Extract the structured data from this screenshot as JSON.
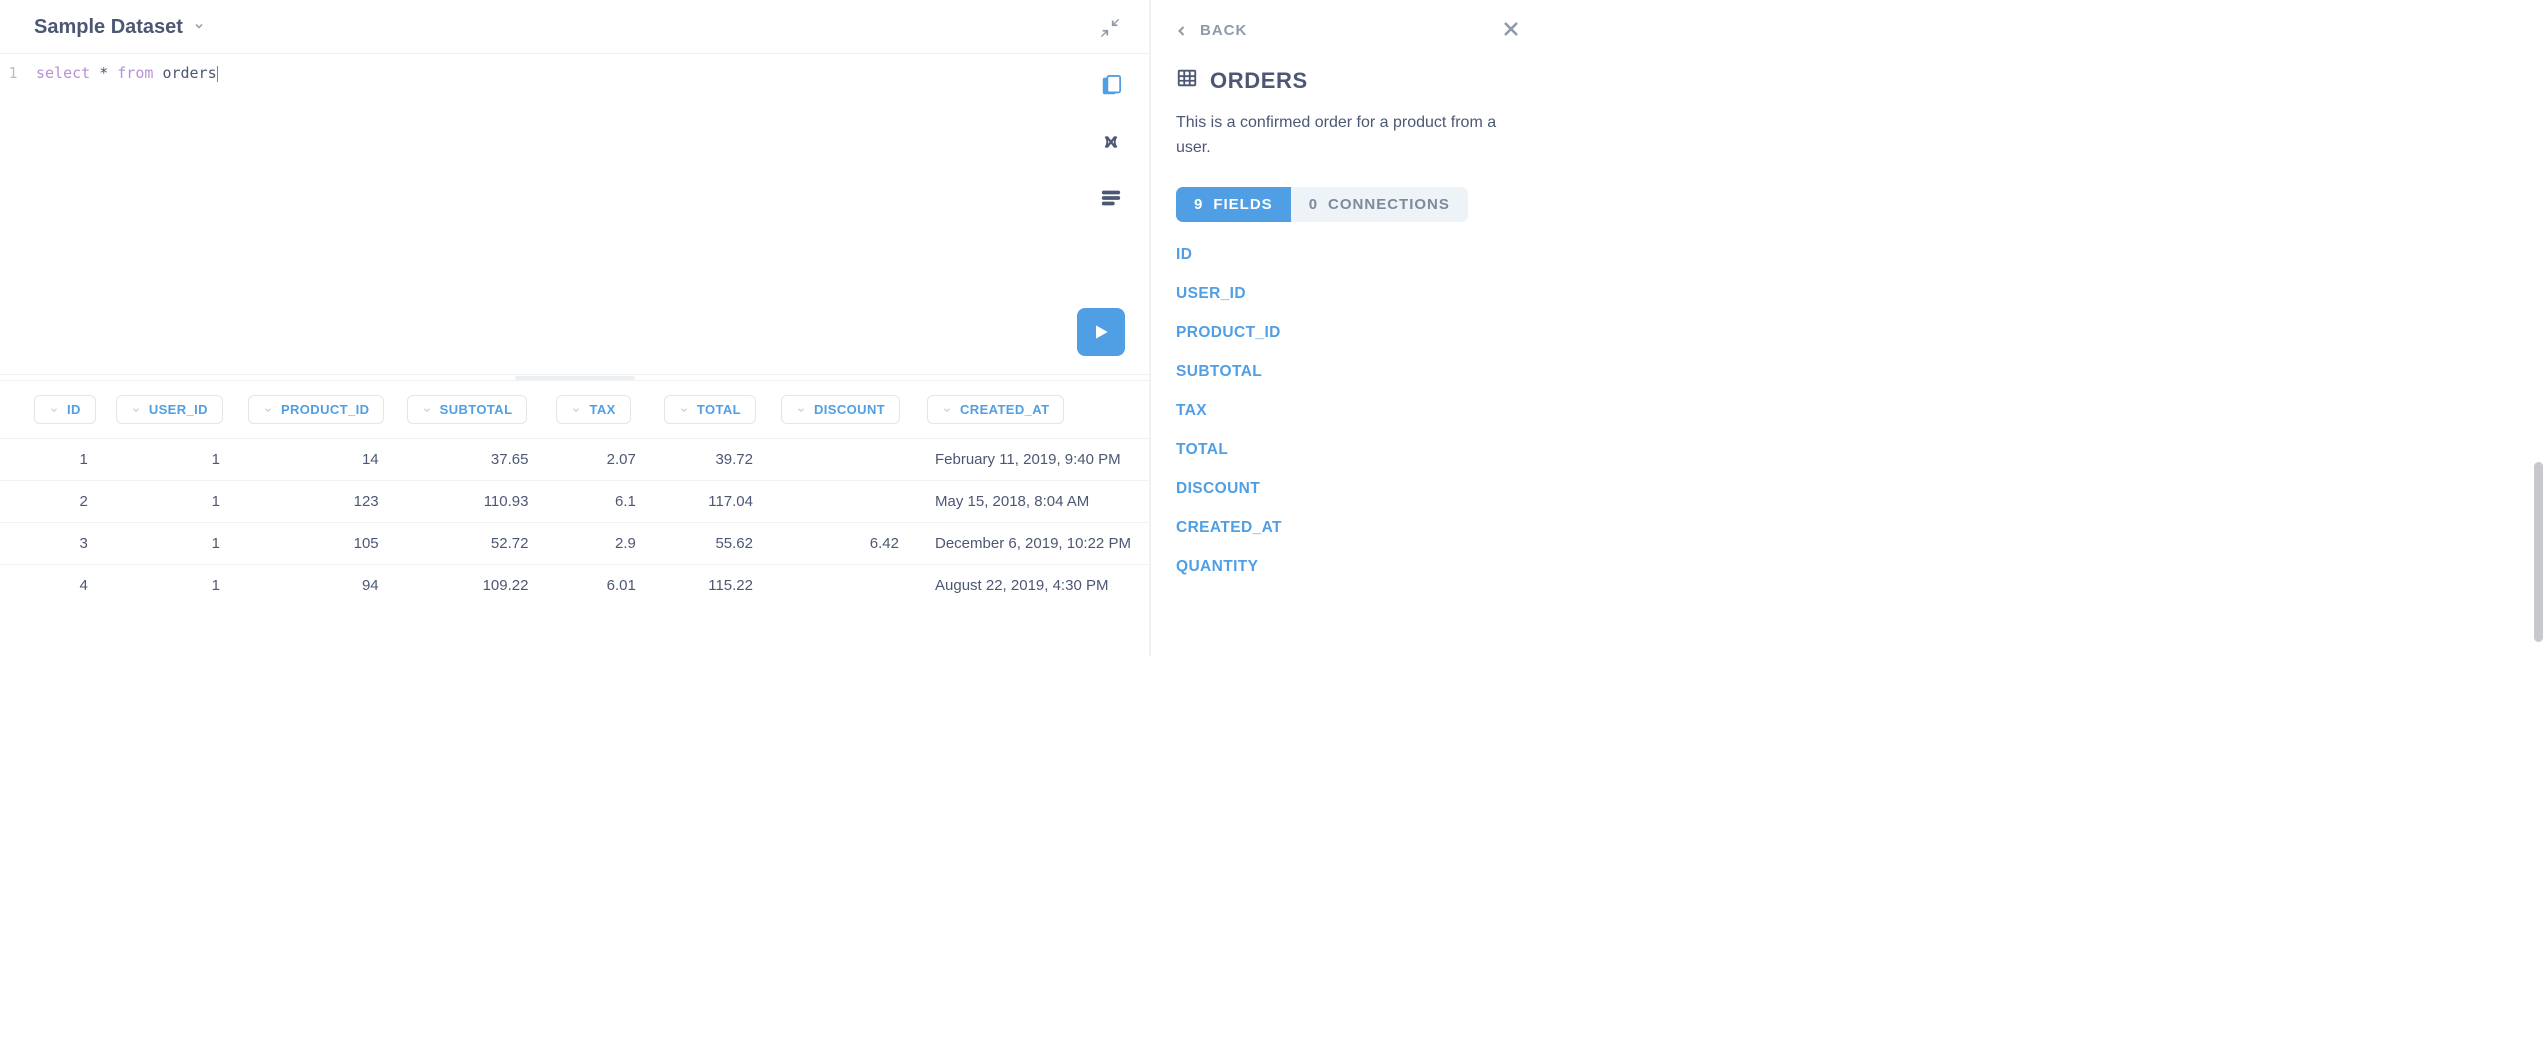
{
  "header": {
    "dataset_label": "Sample Dataset"
  },
  "editor": {
    "line_number": "1",
    "kw_select": "select",
    "star": "*",
    "kw_from": "from",
    "ident_orders": "orders"
  },
  "columns": [
    {
      "key": "id",
      "label": "ID",
      "align": "num"
    },
    {
      "key": "user_id",
      "label": "USER_ID",
      "align": "num"
    },
    {
      "key": "product_id",
      "label": "PRODUCT_ID",
      "align": "num"
    },
    {
      "key": "subtotal",
      "label": "SUBTOTAL",
      "align": "num"
    },
    {
      "key": "tax",
      "label": "TAX",
      "align": "num"
    },
    {
      "key": "total",
      "label": "TOTAL",
      "align": "num"
    },
    {
      "key": "discount",
      "label": "DISCOUNT",
      "align": "num"
    },
    {
      "key": "created_at",
      "label": "CREATED_AT",
      "align": "txt"
    }
  ],
  "rows": [
    {
      "id": "1",
      "user_id": "1",
      "product_id": "14",
      "subtotal": "37.65",
      "tax": "2.07",
      "total": "39.72",
      "discount": "",
      "created_at": "February 11, 2019, 9:40 PM"
    },
    {
      "id": "2",
      "user_id": "1",
      "product_id": "123",
      "subtotal": "110.93",
      "tax": "6.1",
      "total": "117.04",
      "discount": "",
      "created_at": "May 15, 2018, 8:04 AM"
    },
    {
      "id": "3",
      "user_id": "1",
      "product_id": "105",
      "subtotal": "52.72",
      "tax": "2.9",
      "total": "55.62",
      "discount": "6.42",
      "created_at": "December 6, 2019, 10:22 PM"
    },
    {
      "id": "4",
      "user_id": "1",
      "product_id": "94",
      "subtotal": "109.22",
      "tax": "6.01",
      "total": "115.22",
      "discount": "",
      "created_at": "August 22, 2019, 4:30 PM"
    }
  ],
  "panel": {
    "back_label": "BACK",
    "title": "ORDERS",
    "description": "This is a confirmed order for a product from a user.",
    "fields_count": "9",
    "fields_label": "FIELDS",
    "connections_count": "0",
    "connections_label": "CONNECTIONS",
    "fields": [
      "ID",
      "USER_ID",
      "PRODUCT_ID",
      "SUBTOTAL",
      "TAX",
      "TOTAL",
      "DISCOUNT",
      "CREATED_AT",
      "QUANTITY"
    ]
  },
  "chart_data": {
    "type": "table",
    "columns": [
      "ID",
      "USER_ID",
      "PRODUCT_ID",
      "SUBTOTAL",
      "TAX",
      "TOTAL",
      "DISCOUNT",
      "CREATED_AT"
    ],
    "rows": [
      [
        1,
        1,
        14,
        37.65,
        2.07,
        39.72,
        null,
        "February 11, 2019, 9:40 PM"
      ],
      [
        2,
        1,
        123,
        110.93,
        6.1,
        117.04,
        null,
        "May 15, 2018, 8:04 AM"
      ],
      [
        3,
        1,
        105,
        52.72,
        2.9,
        55.62,
        6.42,
        "December 6, 2019, 10:22 PM"
      ],
      [
        4,
        1,
        94,
        109.22,
        6.01,
        115.22,
        null,
        "August 22, 2019, 4:30 PM"
      ]
    ]
  }
}
